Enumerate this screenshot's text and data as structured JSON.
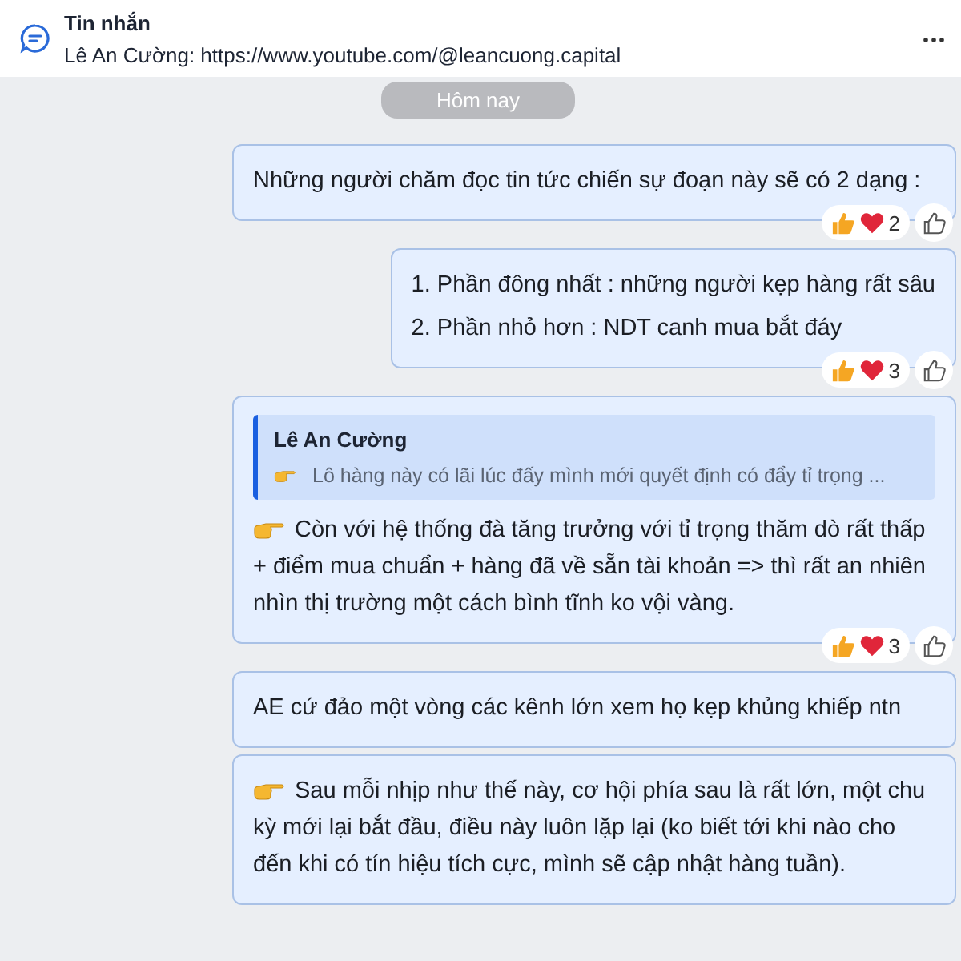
{
  "header": {
    "title": "Tin nhắn",
    "subtitle": "Lê An Cường: https://www.youtube.com/@leancuong.capital"
  },
  "date_chip": "Hôm nay",
  "messages": [
    {
      "pointer": false,
      "lines": [
        "Những người chăm đọc tin tức  chiến sự đoạn này sẽ có 2 dạng :"
      ],
      "reaction_count": "2",
      "full": true
    },
    {
      "pointer": false,
      "lines": [
        "1. Phần đông nhất : những người kẹp hàng rất sâu",
        "2. Phần nhỏ hơn : NDT canh mua bắt đáy"
      ],
      "reaction_count": "3",
      "full": false
    },
    {
      "pointer": true,
      "quote": {
        "author": "Lê An Cường",
        "text": "Lô hàng này có lãi lúc đấy mình mới quyết định có đẩy tỉ trọng ..."
      },
      "lines": [
        "Còn với hệ thống đà tăng trưởng với tỉ trọng thăm dò rất thấp + điểm mua chuẩn + hàng đã về sẵn tài khoản => thì rất an nhiên nhìn thị trường một cách bình tĩnh ko vội vàng."
      ],
      "reaction_count": "3",
      "full": true
    },
    {
      "pointer": false,
      "lines": [
        "AE cứ đảo một vòng các kênh lớn xem họ kẹp khủng khiếp ntn"
      ],
      "full": true
    },
    {
      "pointer": true,
      "lines": [
        "Sau mỗi nhịp như thế này, cơ hội phía sau là rất lớn, một chu kỳ mới lại bắt đầu, điều này luôn lặp lại  (ko biết tới khi nào cho đến khi có tín hiệu tích cực, mình sẽ cập nhật hàng tuần)."
      ],
      "full": true
    }
  ]
}
